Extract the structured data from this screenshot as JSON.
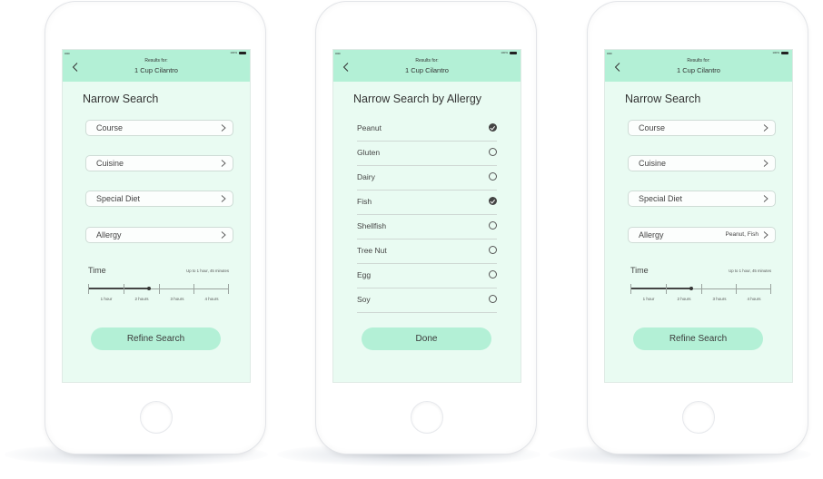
{
  "screens": [
    {
      "status": {
        "signal": "•••••",
        "battery": "100%"
      },
      "header": {
        "results_label": "Results for:",
        "query": "1 Cup Cilantro"
      },
      "title": "Narrow Search",
      "menu": [
        {
          "label": "Course",
          "value": ""
        },
        {
          "label": "Cuisine",
          "value": ""
        },
        {
          "label": "Special Diet",
          "value": ""
        },
        {
          "label": "Allergy",
          "value": ""
        }
      ],
      "time": {
        "label": "Time",
        "value": "Up to 1 hour, 45 minutes",
        "ticks": [
          "1 hour",
          "2 hours",
          "3 hours",
          "4 hours"
        ],
        "selected_fraction": 0.43
      },
      "button": "Refine Search"
    },
    {
      "status": {
        "signal": "•••••",
        "battery": "100%"
      },
      "header": {
        "results_label": "Results for:",
        "query": "1 Cup Cilantro"
      },
      "title": "Narrow Search by Allergy",
      "allergies": [
        {
          "label": "Peanut",
          "selected": true
        },
        {
          "label": "Gluten",
          "selected": false
        },
        {
          "label": "Dairy",
          "selected": false
        },
        {
          "label": "Fish",
          "selected": true
        },
        {
          "label": "Shellfish",
          "selected": false
        },
        {
          "label": "Tree Nut",
          "selected": false
        },
        {
          "label": "Egg",
          "selected": false
        },
        {
          "label": "Soy",
          "selected": false
        }
      ],
      "button": "Done"
    },
    {
      "status": {
        "signal": "•••••",
        "battery": "100%"
      },
      "header": {
        "results_label": "Results for:",
        "query": "1 Cup Cilantro"
      },
      "title": "Narrow Search",
      "menu": [
        {
          "label": "Course",
          "value": ""
        },
        {
          "label": "Cuisine",
          "value": ""
        },
        {
          "label": "Special Diet",
          "value": ""
        },
        {
          "label": "Allergy",
          "value": "Peanut, Fish"
        }
      ],
      "time": {
        "label": "Time",
        "value": "Up to 1 hour, 45 minutes",
        "ticks": [
          "1 hour",
          "2 hours",
          "3 hours",
          "4 hours"
        ],
        "selected_fraction": 0.43
      },
      "button": "Refine Search"
    }
  ],
  "colors": {
    "accent": "#b3f0d6",
    "screen_bg": "#e9fbf2"
  },
  "icons": {
    "back": "chevron-left-icon",
    "row_arrow": "chevron-right-icon",
    "check": "check-circle-icon",
    "radio": "radio-empty-icon"
  }
}
